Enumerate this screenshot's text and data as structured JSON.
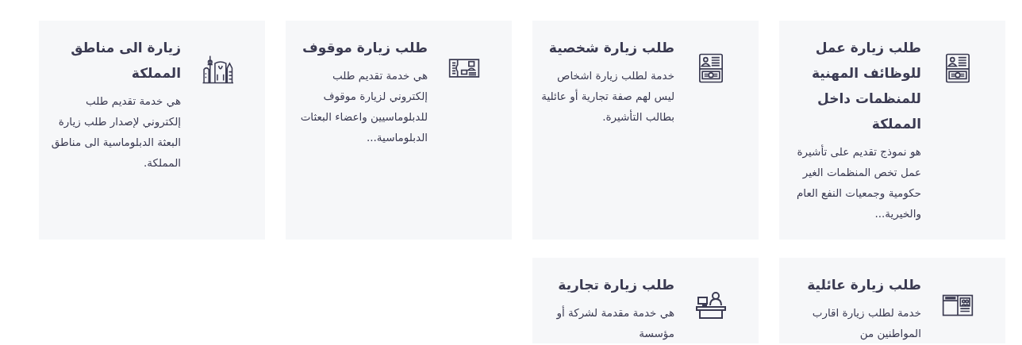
{
  "services": [
    {
      "kind": "document",
      "title": "طلب زيارة عمل للوظائف المهنية للمنظمات داخل المملكة",
      "description": "هو نموذج تقديم على تأشيرة عمل تخص المنظمات الغير حكومية وجمعيات النفع العام والخيرية..."
    },
    {
      "kind": "document",
      "title": "طلب زيارة شخصية",
      "description": "خدمة لطلب زيارة اشخاص ليس لهم صفة تجارية أو عائلية بطالب التأشيرة."
    },
    {
      "kind": "ticket",
      "title": "طلب زيارة موقوف",
      "description": "هي خدمة تقديم طلب إلكتروني لزيارة موقوف للدبلوماسيين واعضاء البعثات الدبلوماسية..."
    },
    {
      "kind": "skyline",
      "title": "زيارة الى مناطق المملكة",
      "description": "هي خدمة تقديم طلب إلكتروني لإصدار طلب زيارة البعثة الدبلوماسية الى مناطق المملكة."
    },
    {
      "kind": "visa",
      "title": "طلب زيارة عائلية",
      "description": "خدمة لطلب زيارة اقارب المواطنين من"
    },
    {
      "kind": "desk",
      "title": "طلب زيارة تجارية",
      "description": "هي خدمة مقدمة لشركة أو مؤسسة"
    }
  ]
}
